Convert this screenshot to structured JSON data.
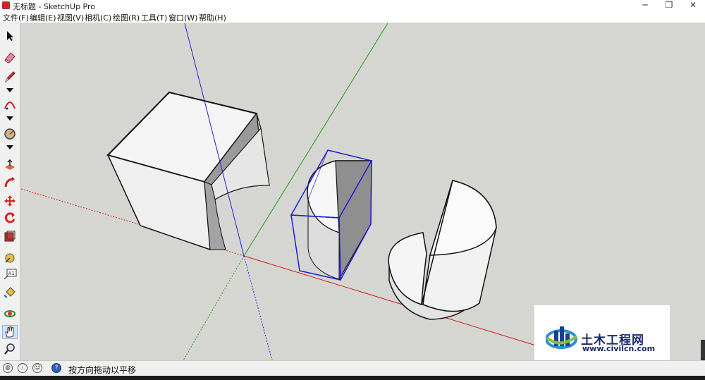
{
  "window": {
    "title": "无标题 - SketchUp Pro",
    "minimize": "─",
    "restore": "❐",
    "close": "✕"
  },
  "menu": [
    {
      "label": "文件(F)"
    },
    {
      "label": "编辑(E)"
    },
    {
      "label": "视图(V)"
    },
    {
      "label": "相机(C)"
    },
    {
      "label": "绘图(R)"
    },
    {
      "label": "工具(T)"
    },
    {
      "label": "窗口(W)"
    },
    {
      "label": "帮助(H)"
    }
  ],
  "toolbar": {
    "tools": [
      {
        "name": "select-tool",
        "icon": "arrow-cursor-icon"
      },
      {
        "name": "eraser-tool",
        "icon": "eraser-icon"
      },
      {
        "name": "pencil-tool",
        "icon": "pencil-icon"
      },
      {
        "name": "arc-tool",
        "icon": "arc-icon"
      },
      {
        "name": "circle-tool",
        "icon": "circle-icon"
      },
      {
        "name": "push-pull-tool",
        "icon": "push-pull-icon"
      },
      {
        "name": "follow-me-tool",
        "icon": "follow-me-icon"
      },
      {
        "name": "move-tool",
        "icon": "move-icon"
      },
      {
        "name": "rotate-tool",
        "icon": "rotate-icon"
      },
      {
        "name": "scale-tool",
        "icon": "scale-icon"
      },
      {
        "name": "tape-measure-tool",
        "icon": "tape-measure-icon"
      },
      {
        "name": "text-tool",
        "icon": "text-icon",
        "label": "A1"
      },
      {
        "name": "paint-bucket-tool",
        "icon": "paint-bucket-icon"
      },
      {
        "name": "orbit-tool",
        "icon": "orbit-icon"
      },
      {
        "name": "pan-tool",
        "icon": "hand-icon",
        "active": true
      },
      {
        "name": "zoom-tool",
        "icon": "magnifier-icon"
      }
    ]
  },
  "colors": {
    "viewport_bg": "#d5d6d1",
    "x_axis": "#d11a1a",
    "y_axis": "#1f9a1f",
    "z_axis": "#2222d0",
    "selection": "#1a1ad8",
    "face": "#f4f4f4",
    "face_shade": "#a9a9a9"
  },
  "status": {
    "text": "按方向拖动以平移",
    "help_icon": "?"
  },
  "watermark": {
    "cn": "土木工程网",
    "url": "www.civilcn.com"
  }
}
